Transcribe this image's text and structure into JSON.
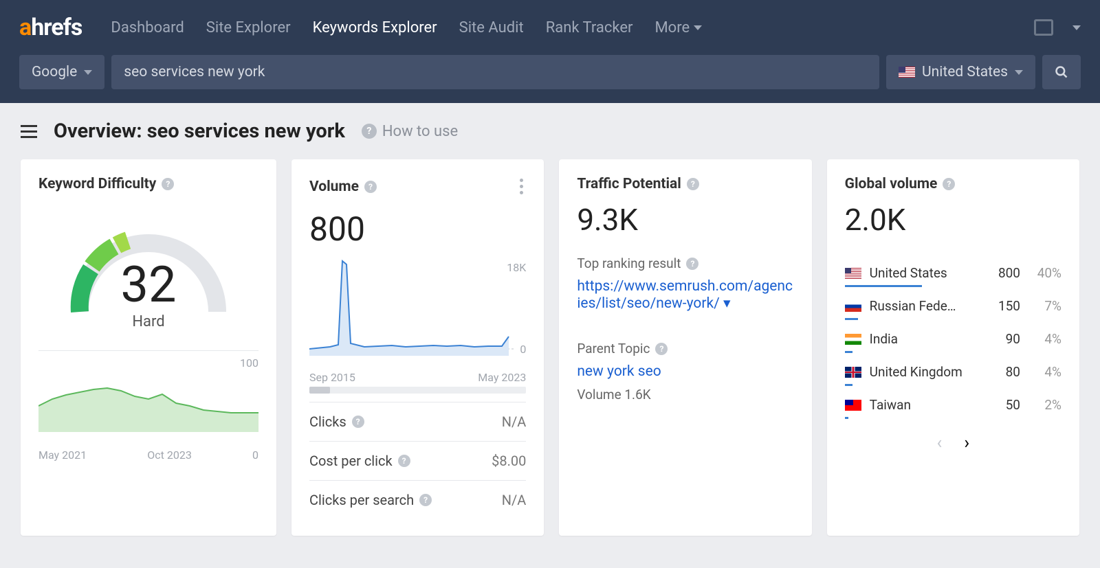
{
  "nav": {
    "items": [
      "Dashboard",
      "Site Explorer",
      "Keywords Explorer",
      "Site Audit",
      "Rank Tracker"
    ],
    "active_index": 2,
    "more": "More"
  },
  "search": {
    "engine": "Google",
    "query": "seo services new york",
    "country": "United States"
  },
  "page": {
    "title": "Overview: seo services new york",
    "howto": "How to use"
  },
  "kd": {
    "title": "Keyword Difficulty",
    "value": "32",
    "label": "Hard",
    "trend_max": "100",
    "trend_start": "May 2021",
    "trend_end": "Oct 2023",
    "trend_zero": "0"
  },
  "volume": {
    "title": "Volume",
    "value": "800",
    "chart_max": "18K",
    "chart_min": "0",
    "chart_start": "Sep 2015",
    "chart_end": "May 2023",
    "rows": [
      {
        "label": "Clicks",
        "value": "N/A"
      },
      {
        "label": "Cost per click",
        "value": "$8.00"
      },
      {
        "label": "Clicks per search",
        "value": "N/A"
      }
    ]
  },
  "tp": {
    "title": "Traffic Potential",
    "value": "9.3K",
    "top_ranking_label": "Top ranking result",
    "top_ranking_url": "https://www.semrush.com/agencies/list/seo/new-york/",
    "parent_label": "Parent Topic",
    "parent_topic": "new york seo",
    "parent_volume": "Volume 1.6K"
  },
  "gv": {
    "title": "Global volume",
    "value": "2.0K",
    "countries": [
      {
        "name": "United States",
        "vol": "800",
        "pct": "40%",
        "bar": 40,
        "flag": "us"
      },
      {
        "name": "Russian Fede…",
        "vol": "150",
        "pct": "7%",
        "bar": 7,
        "flag": "ru"
      },
      {
        "name": "India",
        "vol": "90",
        "pct": "4%",
        "bar": 4,
        "flag": "in"
      },
      {
        "name": "United Kingdom",
        "vol": "80",
        "pct": "4%",
        "bar": 4,
        "flag": "uk"
      },
      {
        "name": "Taiwan",
        "vol": "50",
        "pct": "2%",
        "bar": 2,
        "flag": "tw"
      }
    ]
  },
  "chart_data": [
    {
      "type": "line",
      "title": "Keyword Difficulty trend",
      "x_start": "May 2021",
      "x_end": "Oct 2023",
      "ylim": [
        0,
        100
      ],
      "values": [
        28,
        32,
        36,
        38,
        40,
        38,
        35,
        30,
        32,
        33,
        30,
        28,
        26,
        25,
        24,
        24
      ]
    },
    {
      "type": "line",
      "title": "Volume trend",
      "x_start": "Sep 2015",
      "x_end": "May 2023",
      "ylim": [
        0,
        18000
      ],
      "values": [
        600,
        700,
        800,
        18000,
        17000,
        900,
        800,
        800,
        850,
        800,
        800,
        850,
        800,
        800,
        800,
        850,
        800,
        800,
        900,
        800,
        800,
        800,
        850,
        800,
        800,
        800,
        800,
        800
      ]
    },
    {
      "type": "bar",
      "title": "Global volume by country",
      "categories": [
        "United States",
        "Russian Federation",
        "India",
        "United Kingdom",
        "Taiwan"
      ],
      "values": [
        800,
        150,
        90,
        80,
        50
      ]
    }
  ]
}
